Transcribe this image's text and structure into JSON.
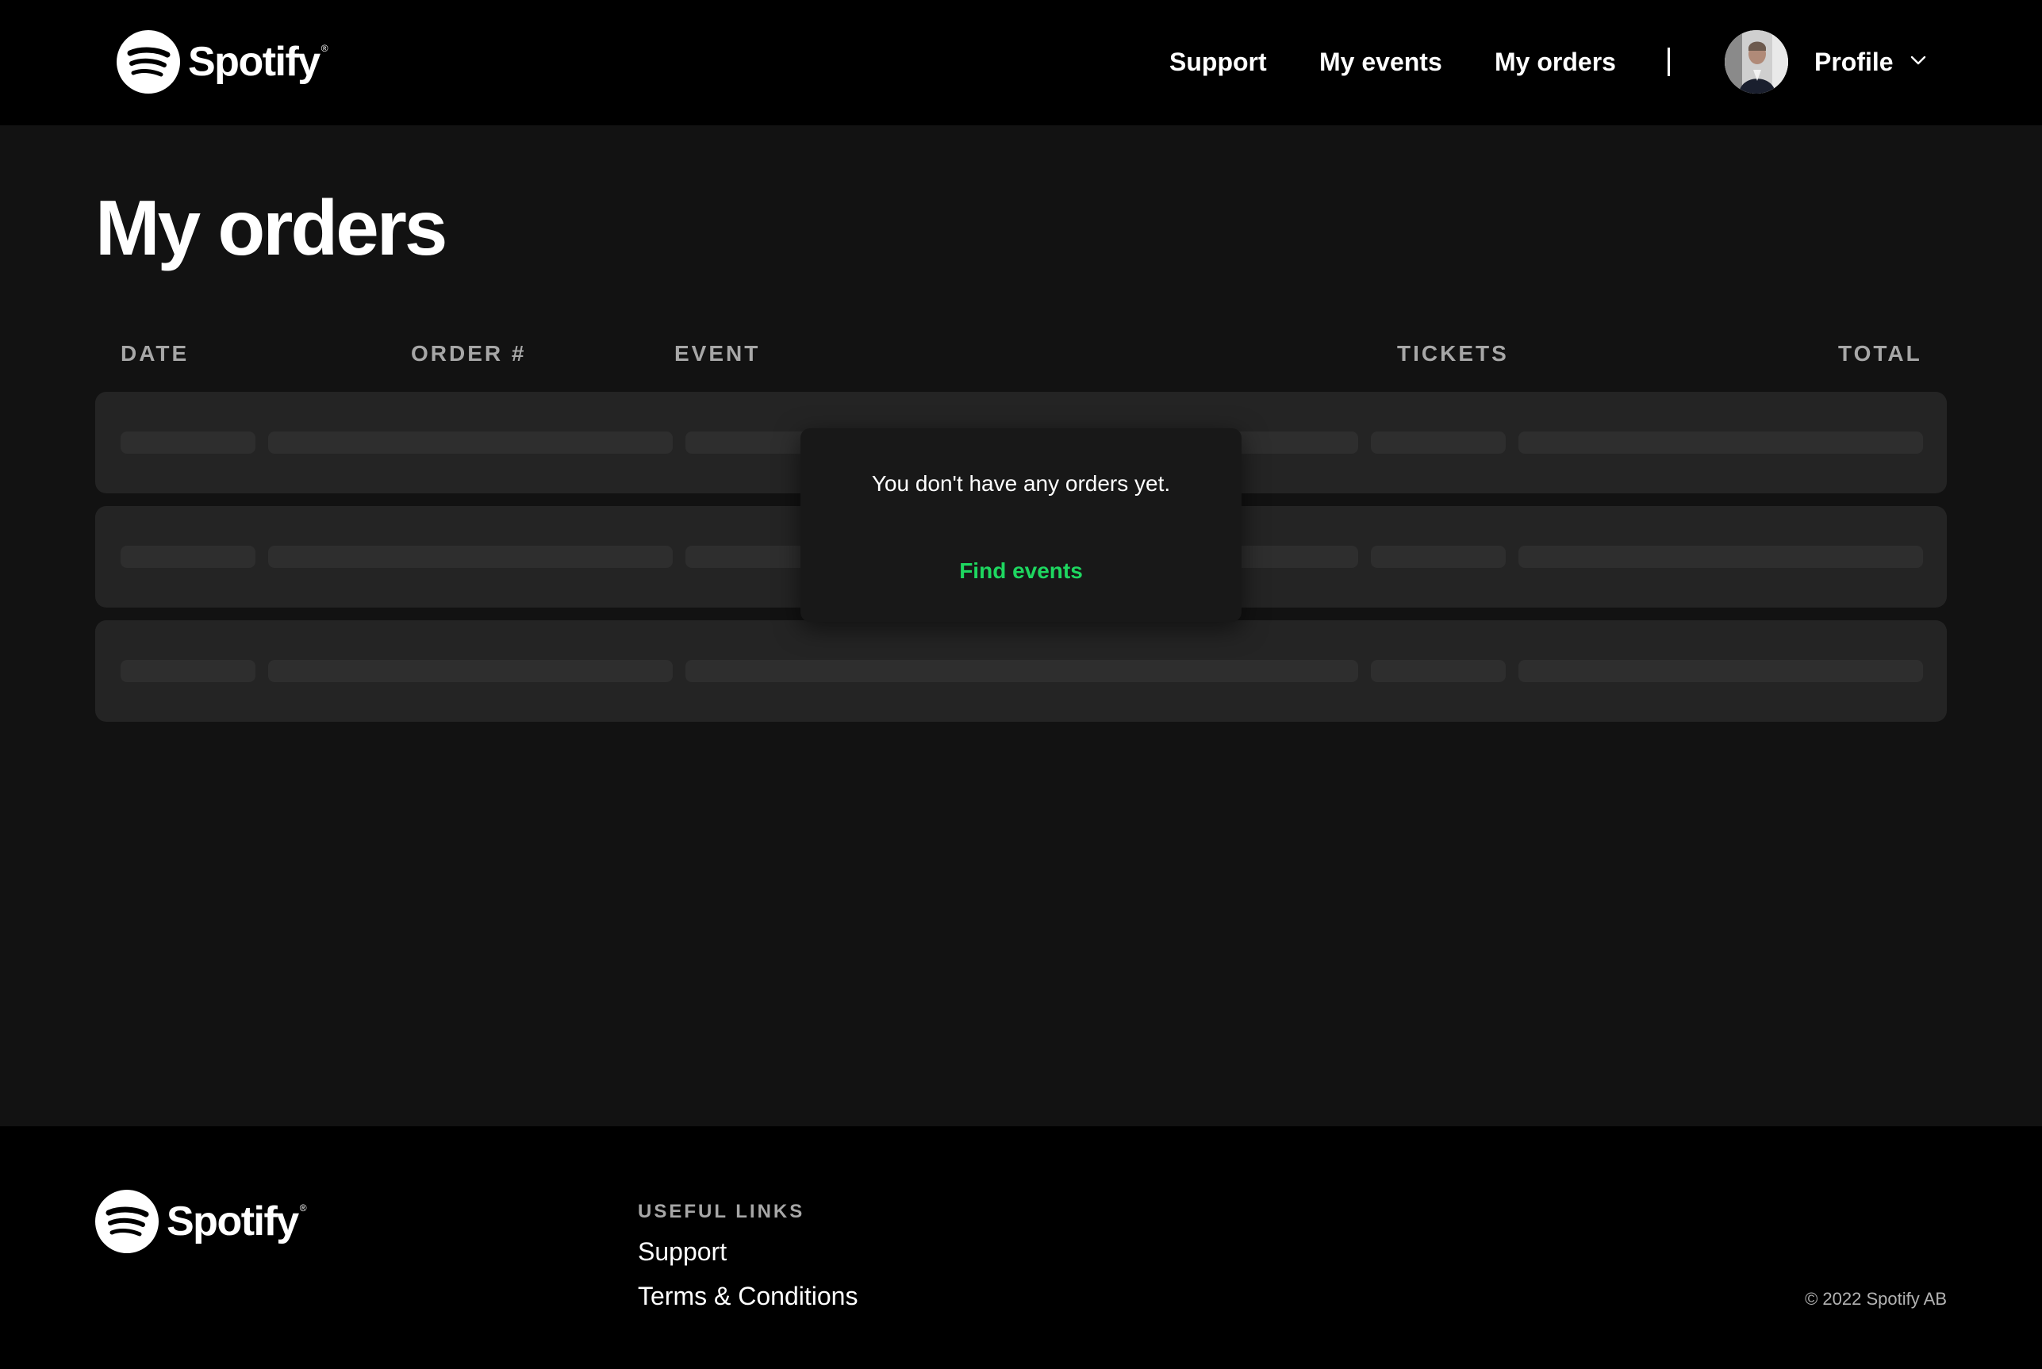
{
  "header": {
    "brand": "Spotify",
    "brand_mark": "®",
    "nav": {
      "support": "Support",
      "my_events": "My events",
      "my_orders": "My orders"
    },
    "profile_label": "Profile"
  },
  "main": {
    "title": "My orders",
    "columns": {
      "date": "DATE",
      "order": "ORDER #",
      "event": "EVENT",
      "tickets": "TICKETS",
      "total": "TOTAL"
    },
    "placeholder_rows": 3,
    "empty_state": {
      "message": "You don't have any orders yet.",
      "action": "Find events"
    }
  },
  "footer": {
    "brand": "Spotify",
    "brand_mark": "®",
    "useful_links_heading": "USEFUL LINKS",
    "links": [
      "Support",
      "Terms & Conditions"
    ],
    "copyright": "© 2022 Spotify AB"
  },
  "colors": {
    "background": "#121212",
    "header_footer": "#000000",
    "row": "#242424",
    "skeleton": "#2e2e2e",
    "accent": "#1ed760",
    "muted_text": "#a7a7a7"
  },
  "icons": [
    "spotify-logo-icon",
    "chevron-down-icon",
    "avatar"
  ]
}
